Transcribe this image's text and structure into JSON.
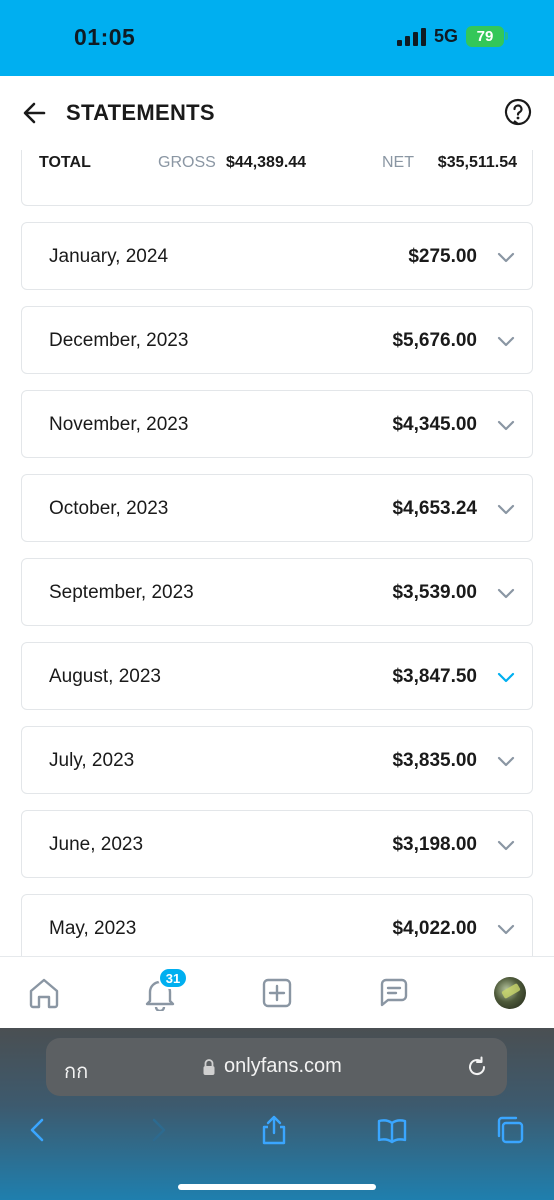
{
  "status_bar": {
    "time": "01:05",
    "network": "5G",
    "battery": "79"
  },
  "header": {
    "title": "STATEMENTS"
  },
  "totals": {
    "total_label": "TOTAL",
    "gross_label": "GROSS",
    "gross_value": "$44,389.44",
    "net_label": "NET",
    "net_value": "$35,511.54"
  },
  "statements": [
    {
      "month": "January, 2024",
      "amount": "$275.00"
    },
    {
      "month": "December, 2023",
      "amount": "$5,676.00"
    },
    {
      "month": "November, 2023",
      "amount": "$4,345.00"
    },
    {
      "month": "October, 2023",
      "amount": "$4,653.24"
    },
    {
      "month": "September, 2023",
      "amount": "$3,539.00"
    },
    {
      "month": "August, 2023",
      "amount": "$3,847.50",
      "highlighted": true
    },
    {
      "month": "July, 2023",
      "amount": "$3,835.00"
    },
    {
      "month": "June, 2023",
      "amount": "$3,198.00"
    },
    {
      "month": "May, 2023",
      "amount": "$4,022.00"
    }
  ],
  "bottom_nav": {
    "notifications_badge": "31",
    "items": [
      "home-icon",
      "bell-icon",
      "add-post-icon",
      "messages-icon",
      "avatar"
    ]
  },
  "browser": {
    "aa_label": "กก",
    "url": "onlyfans.com"
  },
  "colors": {
    "brand": "#00aff0",
    "chevron_default": "#8a96a3",
    "chevron_active": "#00aff0"
  }
}
